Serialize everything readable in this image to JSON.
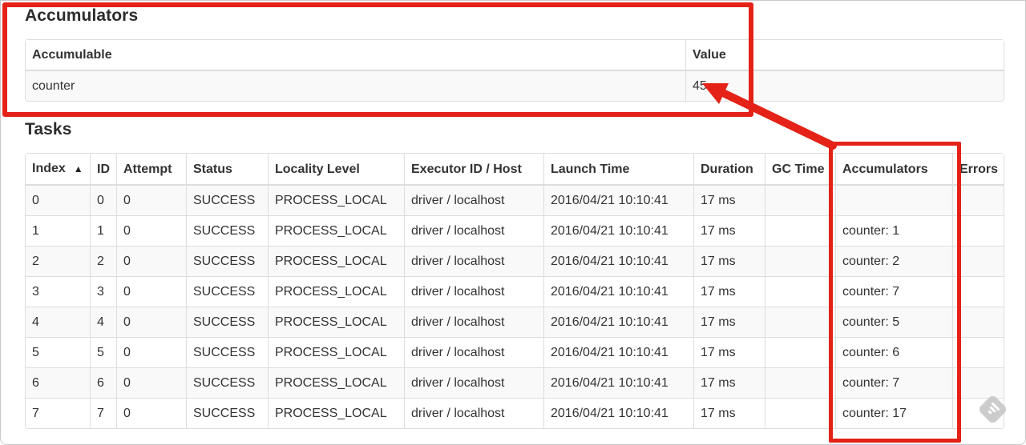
{
  "accumulators_section": {
    "title": "Accumulators",
    "table": {
      "col_accumulable": "Accumulable",
      "col_value": "Value",
      "row": {
        "accumulable": "counter",
        "value": "45"
      }
    }
  },
  "tasks_section": {
    "title": "Tasks",
    "table": {
      "headers": {
        "index": "Index",
        "sort_arrow": "▲",
        "id": "ID",
        "attempt": "Attempt",
        "status": "Status",
        "locality": "Locality Level",
        "executor": "Executor ID / Host",
        "launch": "Launch Time",
        "duration": "Duration",
        "gc": "GC Time",
        "accumulators": "Accumulators",
        "errors": "Errors"
      },
      "rows": [
        {
          "index": "0",
          "id": "0",
          "attempt": "0",
          "status": "SUCCESS",
          "locality": "PROCESS_LOCAL",
          "executor": "driver / localhost",
          "launch": "2016/04/21 10:10:41",
          "duration": "17 ms",
          "gc": "",
          "accumulators": "",
          "errors": ""
        },
        {
          "index": "1",
          "id": "1",
          "attempt": "0",
          "status": "SUCCESS",
          "locality": "PROCESS_LOCAL",
          "executor": "driver / localhost",
          "launch": "2016/04/21 10:10:41",
          "duration": "17 ms",
          "gc": "",
          "accumulators": "counter: 1",
          "errors": ""
        },
        {
          "index": "2",
          "id": "2",
          "attempt": "0",
          "status": "SUCCESS",
          "locality": "PROCESS_LOCAL",
          "executor": "driver / localhost",
          "launch": "2016/04/21 10:10:41",
          "duration": "17 ms",
          "gc": "",
          "accumulators": "counter: 2",
          "errors": ""
        },
        {
          "index": "3",
          "id": "3",
          "attempt": "0",
          "status": "SUCCESS",
          "locality": "PROCESS_LOCAL",
          "executor": "driver / localhost",
          "launch": "2016/04/21 10:10:41",
          "duration": "17 ms",
          "gc": "",
          "accumulators": "counter: 7",
          "errors": ""
        },
        {
          "index": "4",
          "id": "4",
          "attempt": "0",
          "status": "SUCCESS",
          "locality": "PROCESS_LOCAL",
          "executor": "driver / localhost",
          "launch": "2016/04/21 10:10:41",
          "duration": "17 ms",
          "gc": "",
          "accumulators": "counter: 5",
          "errors": ""
        },
        {
          "index": "5",
          "id": "5",
          "attempt": "0",
          "status": "SUCCESS",
          "locality": "PROCESS_LOCAL",
          "executor": "driver / localhost",
          "launch": "2016/04/21 10:10:41",
          "duration": "17 ms",
          "gc": "",
          "accumulators": "counter: 6",
          "errors": ""
        },
        {
          "index": "6",
          "id": "6",
          "attempt": "0",
          "status": "SUCCESS",
          "locality": "PROCESS_LOCAL",
          "executor": "driver / localhost",
          "launch": "2016/04/21 10:10:41",
          "duration": "17 ms",
          "gc": "",
          "accumulators": "counter: 7",
          "errors": ""
        },
        {
          "index": "7",
          "id": "7",
          "attempt": "0",
          "status": "SUCCESS",
          "locality": "PROCESS_LOCAL",
          "executor": "driver / localhost",
          "launch": "2016/04/21 10:10:41",
          "duration": "17 ms",
          "gc": "",
          "accumulators": "counter: 17",
          "errors": ""
        }
      ]
    }
  },
  "annotations": {
    "color": "#e42217",
    "boxes": [
      "accumulators-section-highlight",
      "tasks-accumulators-column-highlight"
    ],
    "arrow": "points-from-accumulators-column-to-value-45"
  },
  "colors": {
    "table_border": "#dddddd",
    "row_stripe": "#f9f9f9",
    "text": "#333333",
    "watermark_gray": "#cccccc"
  }
}
